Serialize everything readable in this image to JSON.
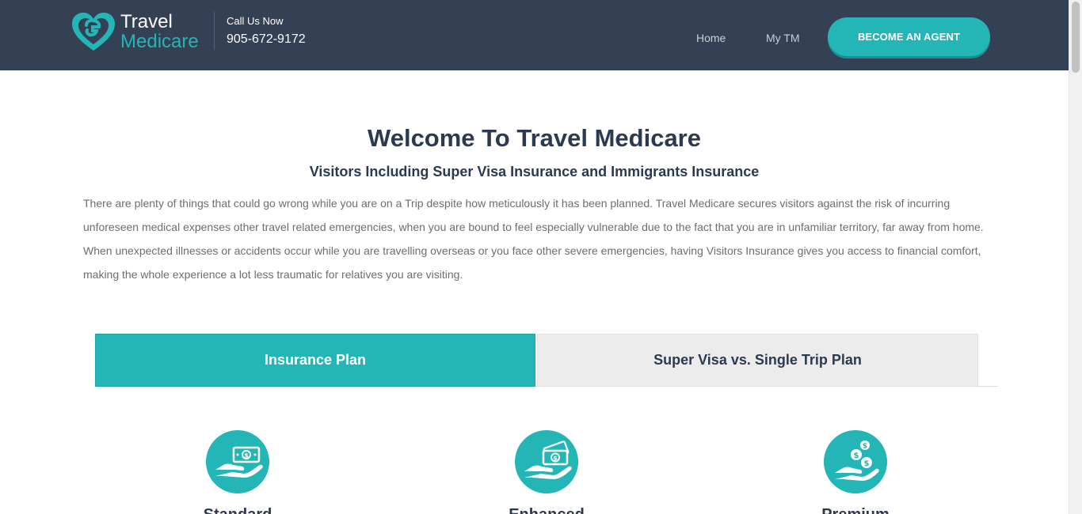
{
  "header": {
    "logo_line1": "Travel",
    "logo_line2": "Medicare",
    "call_label": "Call Us Now",
    "phone": "905-672-9172",
    "nav": [
      {
        "label": "Home"
      },
      {
        "label": "My TM"
      }
    ],
    "cta_label": "BECOME AN AGENT"
  },
  "main": {
    "title": "Welcome To Travel Medicare",
    "subtitle": "Visitors Including Super Visa Insurance and Immigrants Insurance",
    "intro": "There are plenty of things that could go wrong while you are on a Trip despite how meticulously it has been planned. Travel Medicare secures visitors against the risk of incurring unforeseen medical expenses other travel related emergencies, when you are bound to feel especially vulnerable due to the fact that you are in unfamiliar territory, far away from home. When unexpected illnesses or accidents occur while you are travelling overseas or you face other severe emergencies, having Visitors Insurance gives you access to financial comfort, making the whole experience a lot less traumatic for relatives you are visiting."
  },
  "tabs": [
    {
      "label": "Insurance Plan",
      "active": true
    },
    {
      "label": "Super Visa vs. Single Trip Plan",
      "active": false
    }
  ],
  "plans": [
    {
      "icon": "hand-cash-icon",
      "label": "Standard"
    },
    {
      "icon": "hand-money-stack-icon",
      "label": "Enhanced"
    },
    {
      "icon": "hand-coins-icon",
      "label": "Premium"
    }
  ],
  "colors": {
    "header_bg": "#344154",
    "accent": "#24b5b6",
    "heading": "#2b3a50",
    "body_text": "#6d6d6d",
    "inactive_tab": "#ececec"
  }
}
